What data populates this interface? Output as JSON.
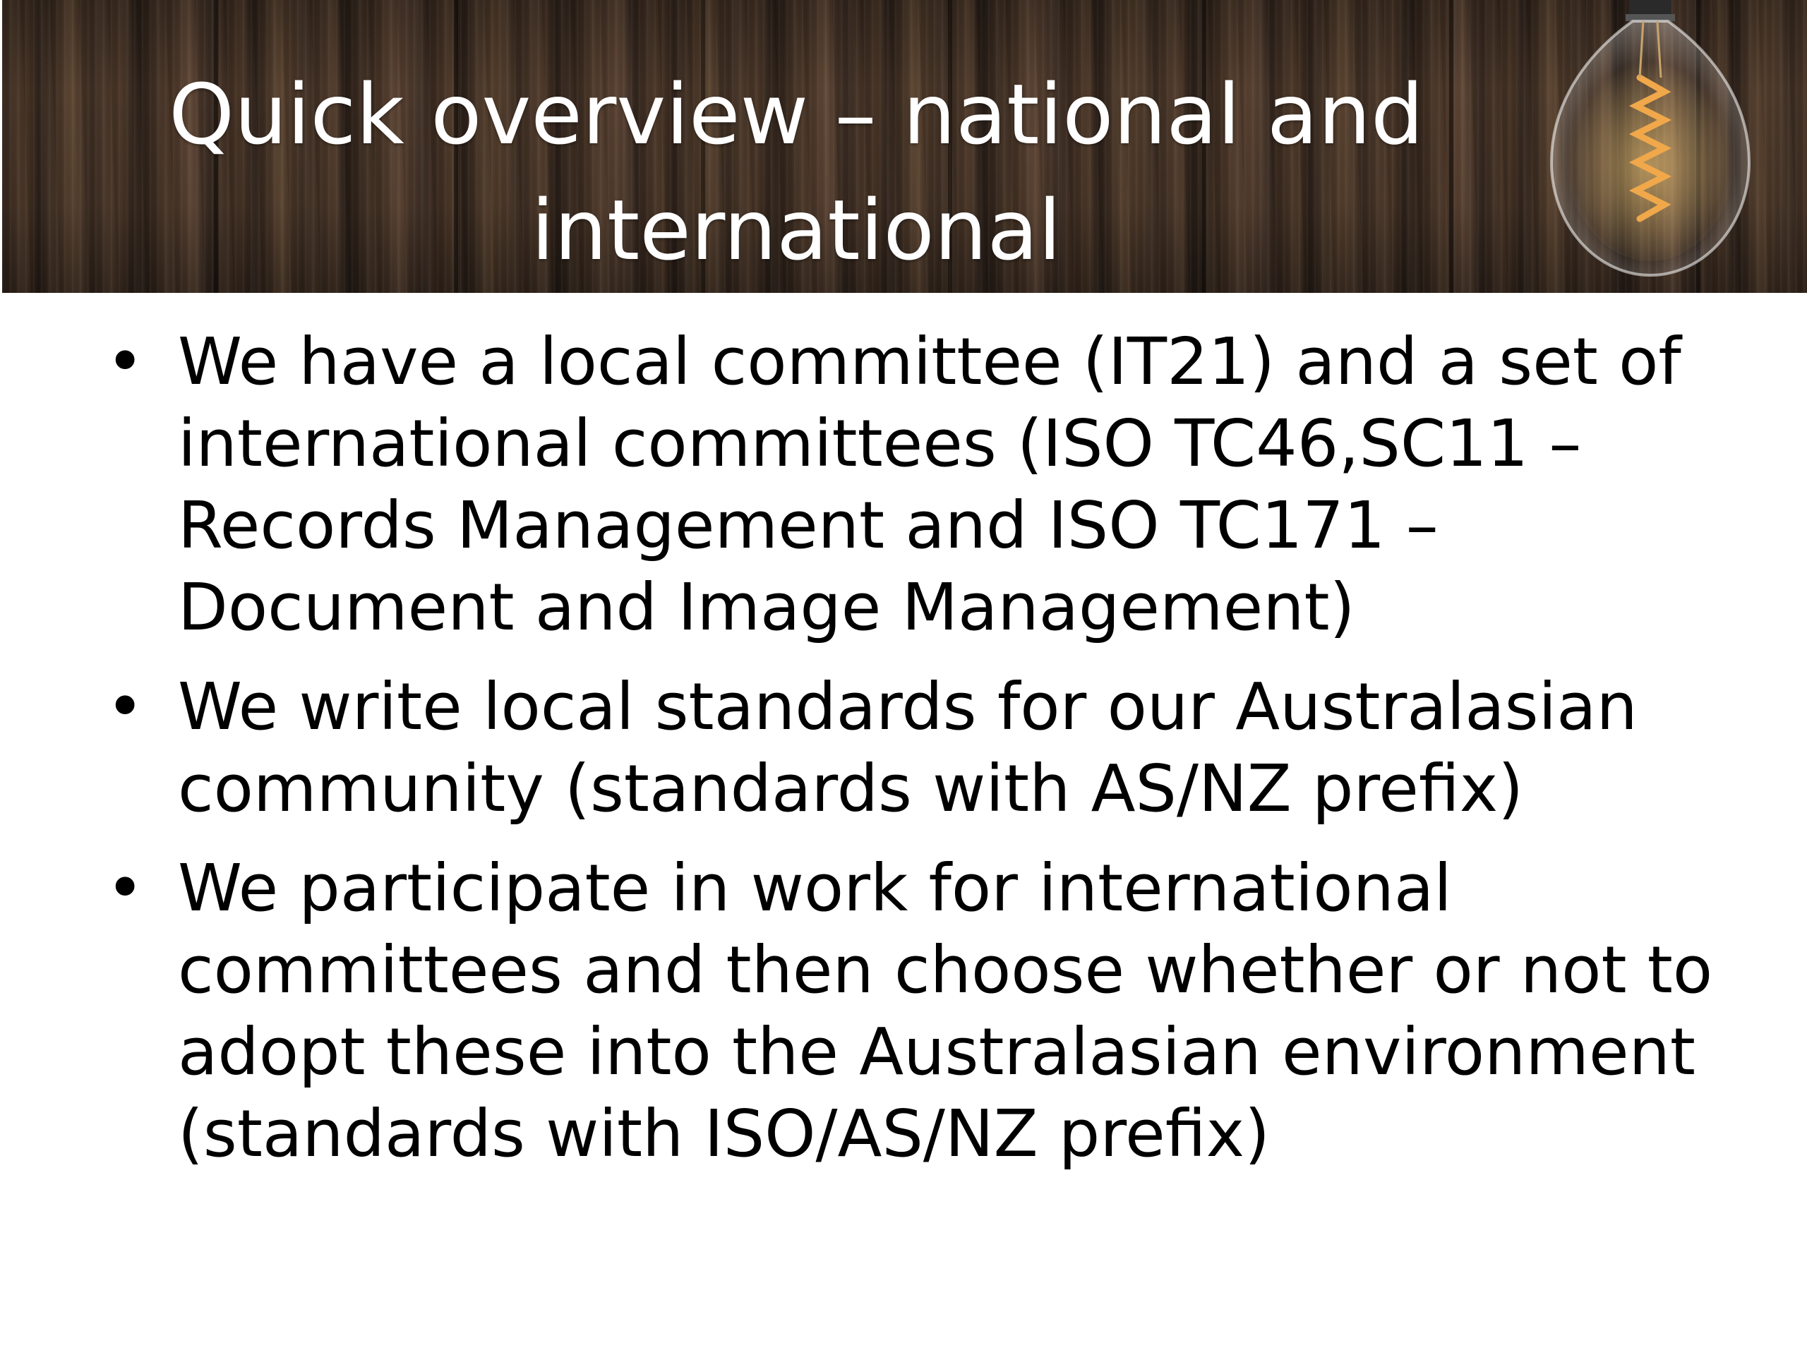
{
  "slide": {
    "title": "Quick overview – national and international",
    "bullet_symbol": "•",
    "bullets": [
      "We have a local committee (IT21) and a set of international committees (ISO TC46,SC11 – Records Management and ISO TC171 – Document and Image Management)",
      "We write local standards for our Australasian community (standards with AS/NZ prefix)",
      "We participate in work for international committees and then choose whether or not to adopt these into the Australasian environment (standards with ISO/AS/NZ prefix)"
    ]
  },
  "icons": {
    "header_decoration": "light-bulb-icon"
  },
  "colors": {
    "title_text": "#ffffff",
    "body_text": "#000000",
    "banner_wood": "#3d2d22",
    "filament_glow": "#f0a84a"
  }
}
